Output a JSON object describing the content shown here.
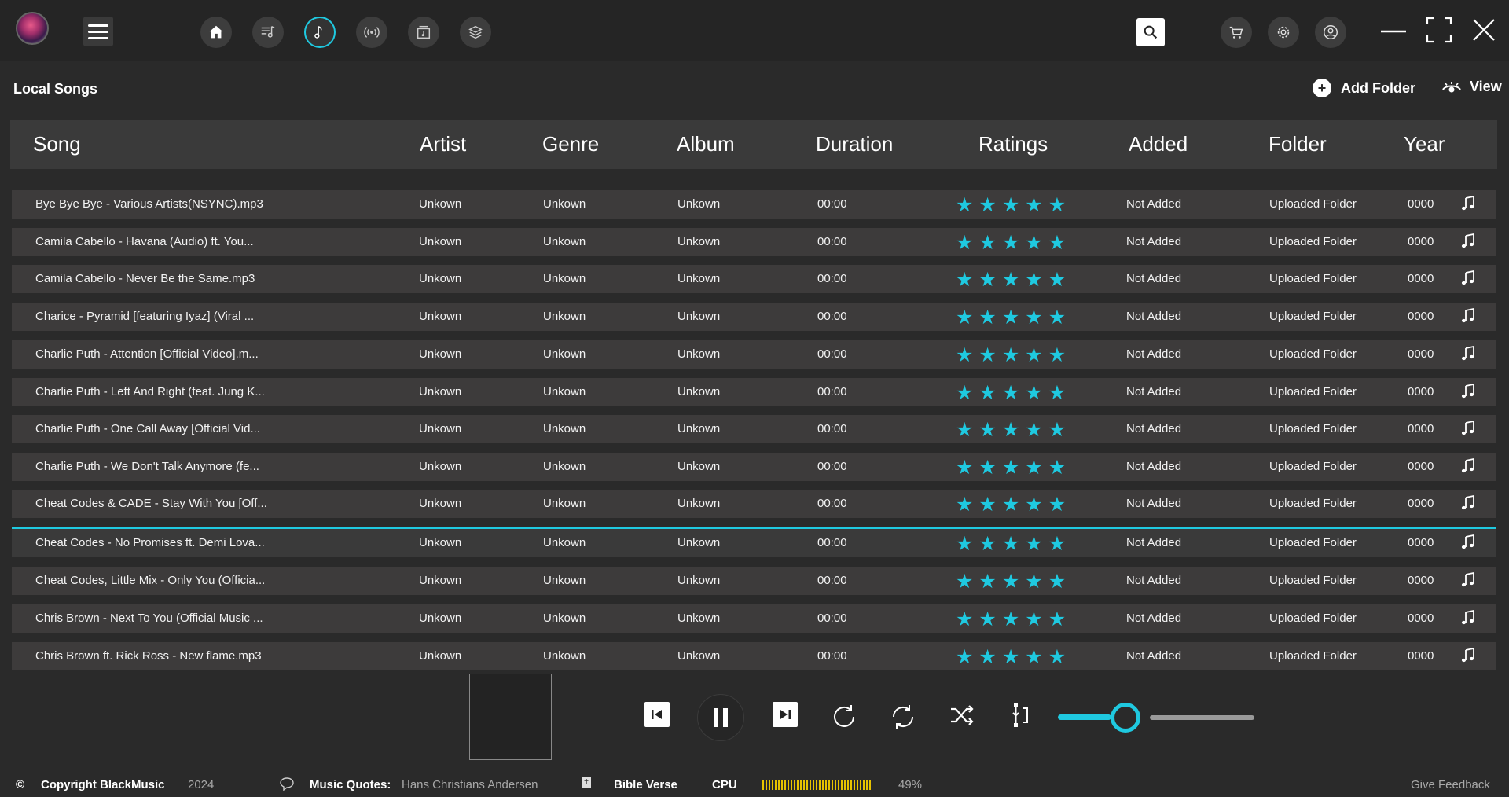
{
  "app": {
    "name": "BlackMusic"
  },
  "nav": {
    "icons": [
      "home-icon",
      "playlist-icon",
      "music-note-icon",
      "radio-icon",
      "album-icon",
      "layers-icon"
    ],
    "active": "music-note-icon"
  },
  "header": {
    "title": "Local Songs",
    "add_folder_label": "Add Folder",
    "view_label": "View"
  },
  "table": {
    "columns": [
      "Song",
      "Artist",
      "Genre",
      "Album",
      "Duration",
      "Ratings",
      "Added",
      "Folder",
      "Year"
    ],
    "rows": [
      {
        "song": "Bye Bye Bye - Various Artists(NSYNC).mp3",
        "artist": "Unkown",
        "genre": "Unkown",
        "album": "Unkown",
        "duration": "00:00",
        "rating": 5,
        "added": "Not Added",
        "folder": "Uploaded Folder",
        "year": "0000"
      },
      {
        "song": "Camila Cabello - Havana (Audio) ft. You...",
        "artist": "Unkown",
        "genre": "Unkown",
        "album": "Unkown",
        "duration": "00:00",
        "rating": 5,
        "added": "Not Added",
        "folder": "Uploaded Folder",
        "year": "0000"
      },
      {
        "song": "Camila Cabello - Never Be the Same.mp3",
        "artist": "Unkown",
        "genre": "Unkown",
        "album": "Unkown",
        "duration": "00:00",
        "rating": 5,
        "added": "Not Added",
        "folder": "Uploaded Folder",
        "year": "0000"
      },
      {
        "song": "Charice - Pyramid [featuring Iyaz] (Viral ...",
        "artist": "Unkown",
        "genre": "Unkown",
        "album": "Unkown",
        "duration": "00:00",
        "rating": 5,
        "added": "Not Added",
        "folder": "Uploaded Folder",
        "year": "0000"
      },
      {
        "song": "Charlie Puth - Attention [Official Video].m...",
        "artist": "Unkown",
        "genre": "Unkown",
        "album": "Unkown",
        "duration": "00:00",
        "rating": 5,
        "added": "Not Added",
        "folder": "Uploaded Folder",
        "year": "0000"
      },
      {
        "song": "Charlie Puth - Left And Right (feat. Jung K...",
        "artist": "Unkown",
        "genre": "Unkown",
        "album": "Unkown",
        "duration": "00:00",
        "rating": 5,
        "added": "Not Added",
        "folder": "Uploaded Folder",
        "year": "0000"
      },
      {
        "song": "Charlie Puth - One Call Away [Official Vid...",
        "artist": "Unkown",
        "genre": "Unkown",
        "album": "Unkown",
        "duration": "00:00",
        "rating": 5,
        "added": "Not Added",
        "folder": "Uploaded Folder",
        "year": "0000"
      },
      {
        "song": "Charlie Puth - We Don't Talk Anymore (fe...",
        "artist": "Unkown",
        "genre": "Unkown",
        "album": "Unkown",
        "duration": "00:00",
        "rating": 5,
        "added": "Not Added",
        "folder": "Uploaded Folder",
        "year": "0000"
      },
      {
        "song": "Cheat Codes & CADE - Stay With You [Off...",
        "artist": "Unkown",
        "genre": "Unkown",
        "album": "Unkown",
        "duration": "00:00",
        "rating": 5,
        "added": "Not Added",
        "folder": "Uploaded Folder",
        "year": "0000"
      },
      {
        "song": "Cheat Codes - No Promises ft. Demi Lova...",
        "artist": "Unkown",
        "genre": "Unkown",
        "album": "Unkown",
        "duration": "00:00",
        "rating": 5,
        "added": "Not Added",
        "folder": "Uploaded Folder",
        "year": "0000",
        "selected": true
      },
      {
        "song": "Cheat Codes, Little Mix - Only You (Officia...",
        "artist": "Unkown",
        "genre": "Unkown",
        "album": "Unkown",
        "duration": "00:00",
        "rating": 5,
        "added": "Not Added",
        "folder": "Uploaded Folder",
        "year": "0000"
      },
      {
        "song": "Chris Brown - Next To You (Official Music ...",
        "artist": "Unkown",
        "genre": "Unkown",
        "album": "Unkown",
        "duration": "00:00",
        "rating": 5,
        "added": "Not Added",
        "folder": "Uploaded Folder",
        "year": "0000"
      },
      {
        "song": "Chris Brown ft. Rick Ross - New flame.mp3",
        "artist": "Unkown",
        "genre": "Unkown",
        "album": "Unkown",
        "duration": "00:00",
        "rating": 5,
        "added": "Not Added",
        "folder": "Uploaded Folder",
        "year": "0000"
      }
    ]
  },
  "player": {
    "volume_fraction": 0.3,
    "accent_color": "#1fc9e0"
  },
  "footer": {
    "copyright_symbol": "©",
    "copyright": "Copyright BlackMusic",
    "year": "2024",
    "quotes_label": "Music Quotes:",
    "quotes_author": "Hans Christians Andersen",
    "bible_label": "Bible Verse",
    "cpu_label": "CPU",
    "cpu_percent": "49%",
    "feedback": "Give Feedback"
  }
}
